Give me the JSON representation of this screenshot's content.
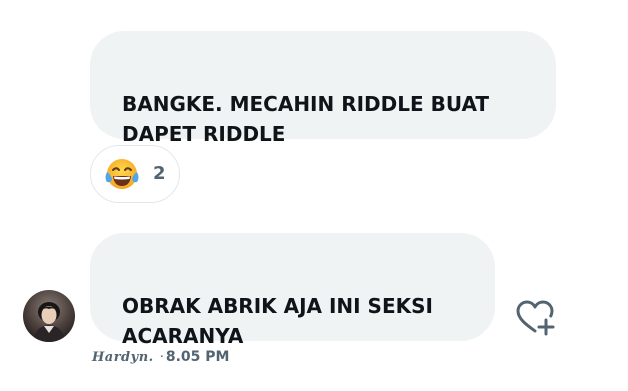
{
  "messages": [
    {
      "text": "BANGKE. MECAHIN RIDDLE BUAT\nDAPET RIDDLE"
    },
    {
      "text": "OBRAK ABRIK AJA INI SEKSI\nACARANYA"
    }
  ],
  "reaction": {
    "emoji_icon": "face-with-tears-of-joy-icon",
    "count": "2"
  },
  "sender": {
    "name": "Hardyn.",
    "separator": "·",
    "time": "8.05 PM"
  },
  "colors": {
    "bubble": "#eff3f4",
    "text": "#0f1419",
    "secondary": "#536471"
  }
}
